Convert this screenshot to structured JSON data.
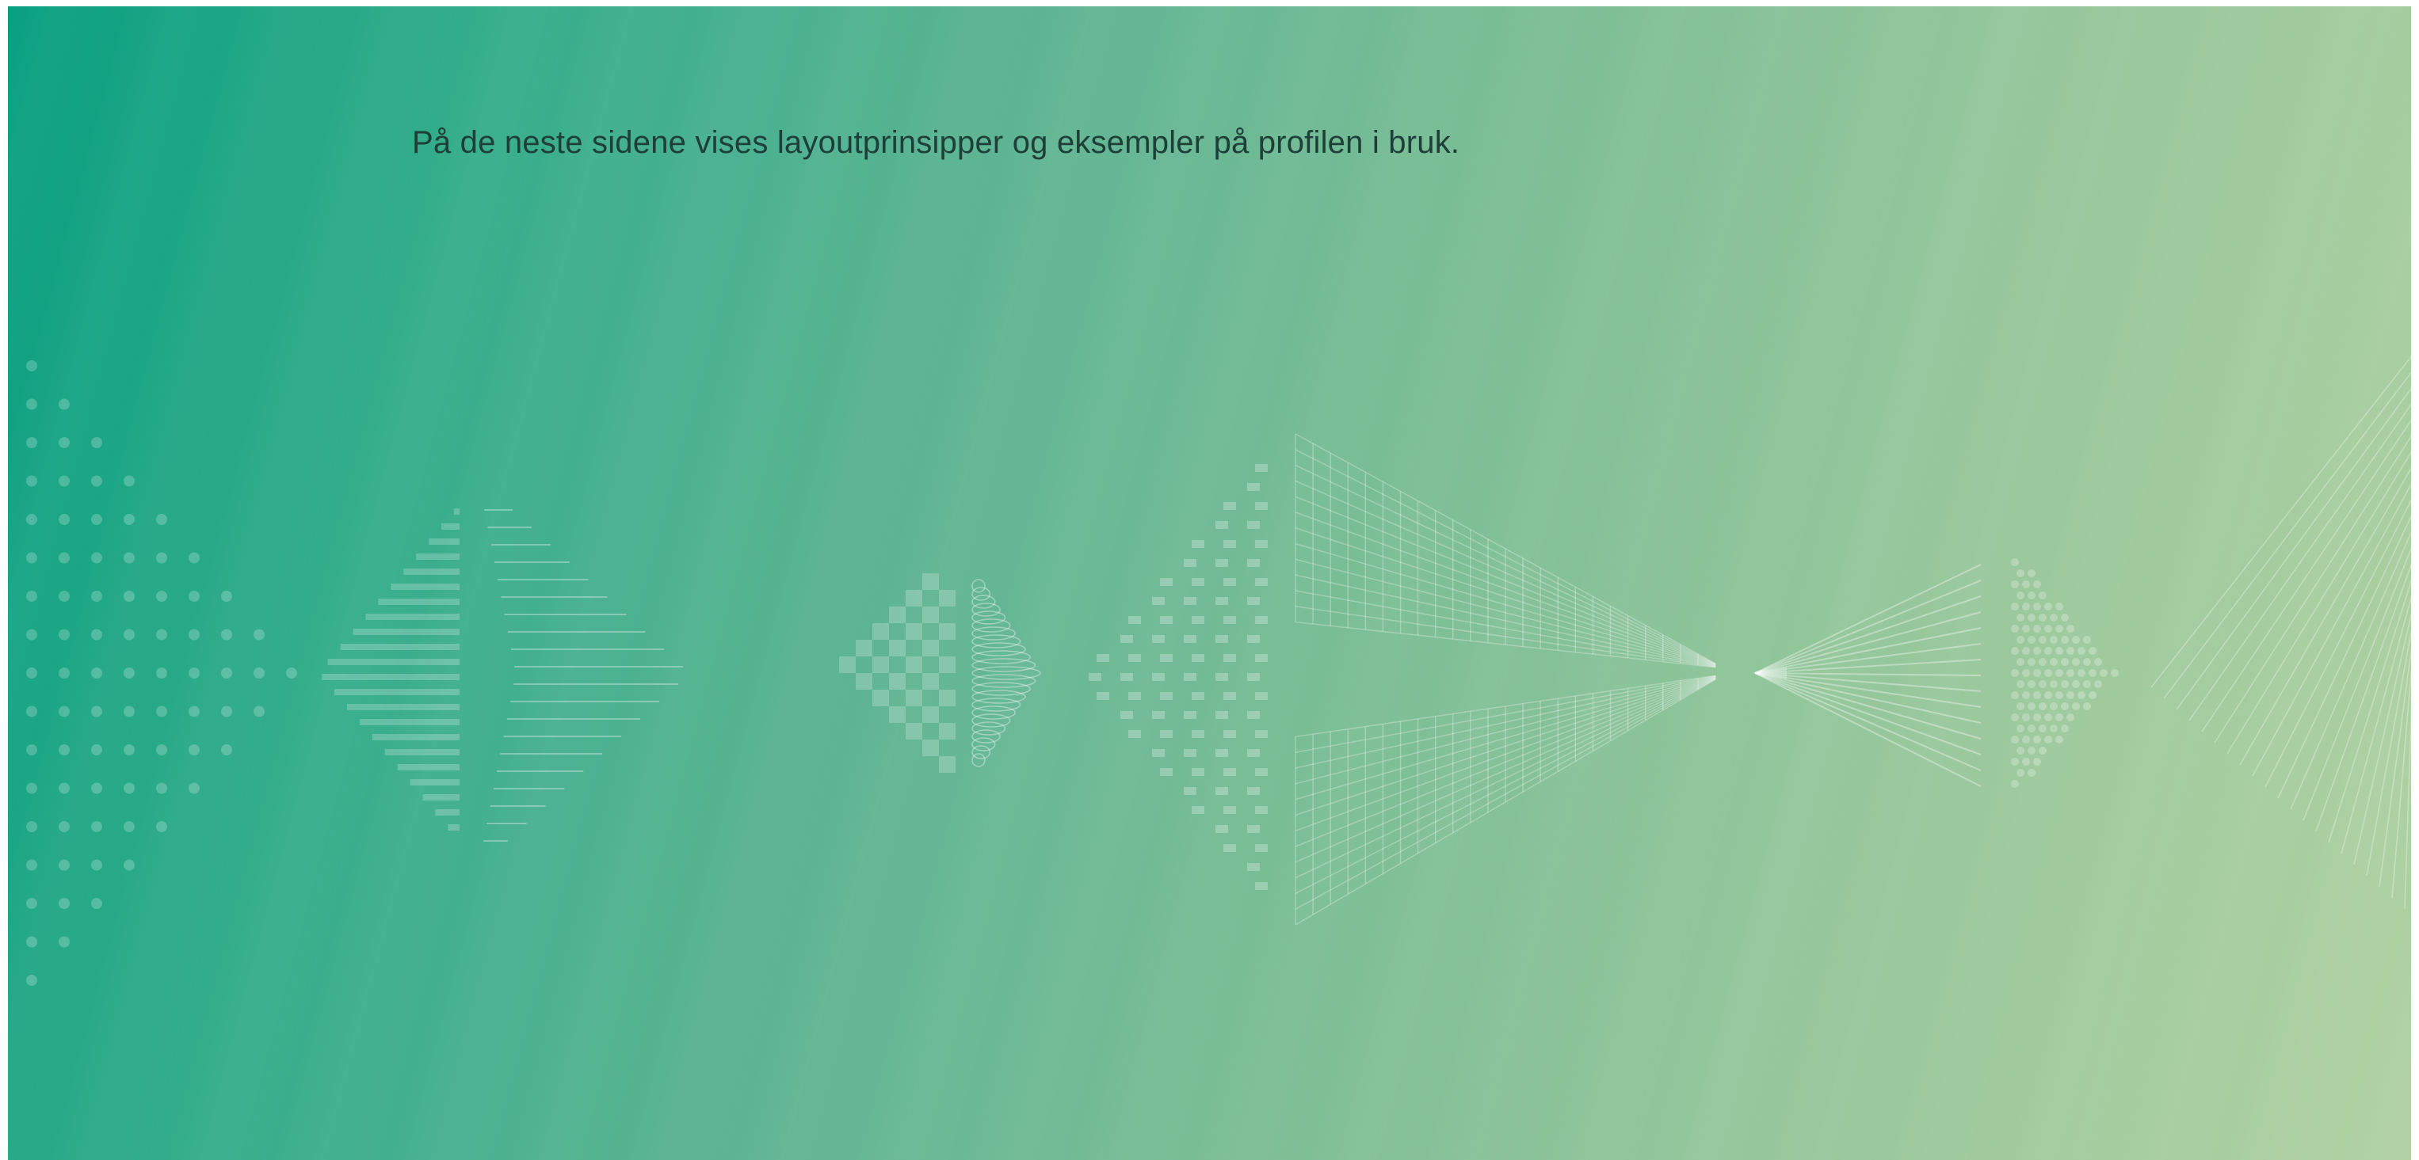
{
  "slide": {
    "intro_text": "På de neste sidene vises layoutprinsipper og eksempler på profilen i bruk."
  },
  "colors": {
    "gradient_start": "#079f80",
    "gradient_end": "#b0d1a2",
    "text": "#1d3f37",
    "pattern": "#ffffff"
  },
  "decorations": [
    "dot-triangle-pattern",
    "striped-diamond-pattern",
    "checker-triangle-pattern",
    "loop-coil-pattern",
    "dash-diamond-pattern",
    "grid-chevron-pattern",
    "fan-lines-pattern",
    "dot-diamond-pattern",
    "diagonal-lines-pattern"
  ]
}
